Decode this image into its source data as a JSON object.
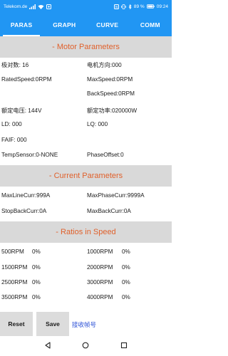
{
  "status_bar": {
    "carrier": "Telekom.de",
    "battery_percent": "89 %",
    "time": "09:24"
  },
  "tabs": [
    {
      "label": "PARAS",
      "active": true
    },
    {
      "label": "GRAPH",
      "active": false
    },
    {
      "label": "CURVE",
      "active": false
    },
    {
      "label": "COMM",
      "active": false
    }
  ],
  "motor": {
    "title": "- Motor Parameters",
    "pole_pairs": "极对数: 16",
    "motor_direction": "电机方向:000",
    "rated_speed": "RatedSpeed:0RPM",
    "max_speed": "MaxSpeed:0RPM",
    "back_speed": "BackSpeed:0RPM",
    "rated_voltage": "额定电压: 144V",
    "rated_power": "额定功率:020000W",
    "ld": "LD: 000",
    "lq": "LQ: 000",
    "faif": "FAIF: 000",
    "temp_sensor": "TempSensor:0-NONE",
    "phase_offset": "PhaseOffset:0"
  },
  "current": {
    "title": "- Current Parameters",
    "max_line_curr": "MaxLineCurr:999A",
    "max_phase_curr": "MaxPhaseCurr:9999A",
    "stop_back_curr": "StopBackCurr:0A",
    "max_back_curr": "MaxBackCurr:0A"
  },
  "ratios": {
    "title": "- Ratios in Speed",
    "rows": [
      {
        "left_rpm": "500RPM",
        "left_val": "0%",
        "right_rpm": "1000RPM",
        "right_val": "0%"
      },
      {
        "left_rpm": "1500RPM",
        "left_val": "0%",
        "right_rpm": "2000RPM",
        "right_val": "0%"
      },
      {
        "left_rpm": "2500RPM",
        "left_val": "0%",
        "right_rpm": "3000RPM",
        "right_val": "0%"
      },
      {
        "left_rpm": "3500RPM",
        "left_val": "0%",
        "right_rpm": "4000RPM",
        "right_val": "0%"
      }
    ]
  },
  "actions": {
    "reset_label": "Reset",
    "save_label": "Save",
    "received_label": "接收帧号"
  },
  "colors": {
    "accent": "#2196f3",
    "section_title": "#e0612c",
    "section_bg": "#d9d9d9",
    "received_text": "#2a4fd6"
  },
  "icons": {
    "status_left": [
      "sim-icon",
      "wifi-icon",
      "notification-icon"
    ],
    "status_right": [
      "nfc-icon",
      "vibrate-icon",
      "bluetooth-icon",
      "battery-icon"
    ],
    "nav": [
      "back-icon",
      "home-icon",
      "recents-icon"
    ]
  }
}
